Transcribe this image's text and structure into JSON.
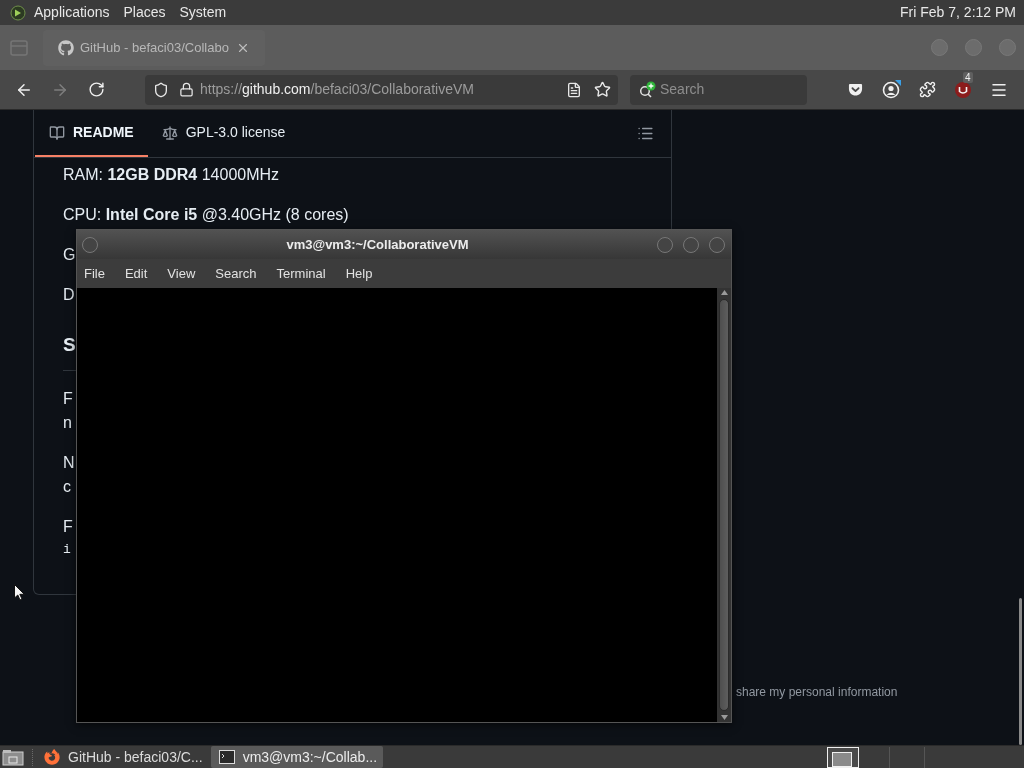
{
  "top_panel": {
    "menus": [
      "Applications",
      "Places",
      "System"
    ],
    "clock": "Fri Feb 7, 2:12 PM"
  },
  "browser": {
    "tabs": [
      {
        "title": "GitHub - befaci03/Collabo",
        "selected": true
      }
    ],
    "nav_buttons": [
      {
        "kind": "back",
        "disabled": false
      },
      {
        "kind": "forward",
        "disabled": true
      },
      {
        "kind": "reload",
        "disabled": false
      }
    ],
    "url": {
      "scheme": "https://",
      "host": "github.com",
      "path": "/befaci03/CollaborativeVM"
    },
    "search": {
      "placeholder": "Search"
    },
    "toolbar": [
      {
        "kind": "pocket"
      },
      {
        "kind": "account"
      },
      {
        "kind": "extensions"
      },
      {
        "kind": "addon",
        "badge": "4"
      },
      {
        "kind": "menu"
      }
    ]
  },
  "readme": {
    "tabs": [
      {
        "kind": "readme",
        "label": "README",
        "selected": true
      },
      {
        "kind": "license",
        "label": "GPL-3.0 license",
        "selected": false
      }
    ],
    "lines": [
      {
        "kind": "text",
        "text": "RAM: **12GB DDR4** 14000MHz"
      },
      {
        "kind": "text",
        "text": "CPU: **Intel Core i5** @3.40GHz (8 cores)"
      },
      {
        "kind": "text",
        "text": "G"
      },
      {
        "kind": "text",
        "text": "D"
      },
      {
        "kind": "heading",
        "text": "S"
      },
      {
        "kind": "text",
        "text": "F"
      },
      {
        "kind": "continued",
        "text": "n"
      },
      {
        "kind": "text",
        "text": "N"
      },
      {
        "kind": "continued",
        "text": "c"
      },
      {
        "kind": "text",
        "text": "F"
      },
      {
        "kind": "code",
        "text": "i"
      }
    ]
  },
  "footer": {
    "text": "share my personal information"
  },
  "terminal": {
    "title": "vm3@vm3:~/CollaborativeVM",
    "menus": [
      "File",
      "Edit",
      "View",
      "Search",
      "Terminal",
      "Help"
    ]
  },
  "taskbar": {
    "tasks": [
      {
        "kind": "browser",
        "label": "GitHub - befaci03/C...",
        "selected": false
      },
      {
        "kind": "terminal",
        "label": "vm3@vm3:~/Collab...",
        "selected": true
      }
    ]
  }
}
